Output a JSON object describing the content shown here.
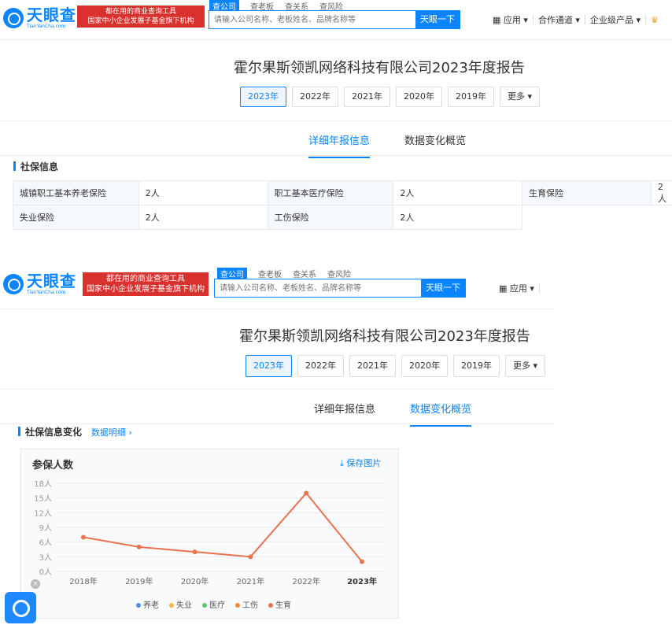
{
  "header": {
    "logo_cn": "天眼查",
    "logo_en": "TianYanCha.com",
    "slogan_line1": "都在用的商业查询工具",
    "slogan_line2": "国家中小企业发展子基金旗下机构",
    "search_tabs": [
      "查公司",
      "查老板",
      "查关系",
      "查风险"
    ],
    "search_placeholder": "请输入公司名称、老板姓名、品牌名称等",
    "search_button": "天眼一下",
    "nav": [
      "应用",
      "合作通道",
      "企业级产品"
    ]
  },
  "report": {
    "title": "霍尔果斯领凯网络科技有限公司2023年度报告",
    "years": [
      "2023年",
      "2022年",
      "2021年",
      "2020年",
      "2019年"
    ],
    "more": "更多",
    "active_year": "2023年",
    "tabs": [
      "详细年报信息",
      "数据变化概览"
    ]
  },
  "social_security": {
    "heading": "社保信息",
    "rows": [
      [
        {
          "k": "城镇职工基本养老保险",
          "v": "2人"
        },
        {
          "k": "职工基本医疗保险",
          "v": "2人"
        },
        {
          "k": "生育保险",
          "v": "2人"
        }
      ],
      [
        {
          "k": "失业保险",
          "v": "2人"
        },
        {
          "k": "工伤保险",
          "v": "2人"
        }
      ]
    ]
  },
  "change_section": {
    "heading": "社保信息变化",
    "detail_link": "数据明细",
    "chart_title": "参保人数",
    "save_label": "保存图片"
  },
  "colors": {
    "accent": "#0a84ff",
    "line": "#e8734e",
    "red": "#d9312e"
  },
  "chart_data": {
    "type": "line",
    "title": "参保人数",
    "x": [
      "2018年",
      "2019年",
      "2020年",
      "2021年",
      "2022年",
      "2023年"
    ],
    "ticks": [
      "0人",
      "3人",
      "6人",
      "9人",
      "12人",
      "15人",
      "18人"
    ],
    "ylim": [
      0,
      18
    ],
    "series": [
      {
        "name": "养老",
        "color": "#4a8ff0",
        "values": []
      },
      {
        "name": "失业",
        "color": "#f5b942",
        "values": []
      },
      {
        "name": "医疗",
        "color": "#5cc56a",
        "values": []
      },
      {
        "name": "工伤",
        "color": "#f08a3a",
        "values": []
      },
      {
        "name": "生育",
        "color": "#e8734e",
        "values": [
          7,
          5,
          4,
          3,
          16,
          2
        ]
      }
    ],
    "legend": "bottom",
    "grid": true
  }
}
